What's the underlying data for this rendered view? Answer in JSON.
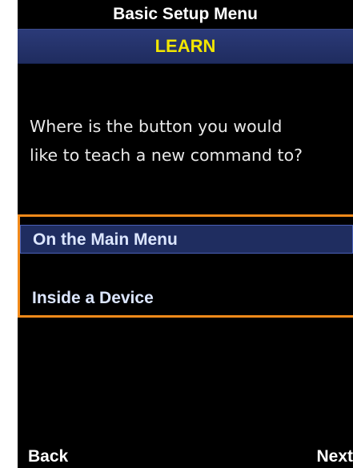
{
  "header": {
    "title": "Basic Setup Menu",
    "subtitle": "LEARN"
  },
  "prompt": {
    "text": "Where is the button you would\nlike to teach a new command to?"
  },
  "options": [
    {
      "label": "On the Main Menu",
      "selected": true
    },
    {
      "label": "Inside a Device",
      "selected": false
    }
  ],
  "softkeys": {
    "left": "Back",
    "right": "Next"
  },
  "colors": {
    "background": "#000000",
    "header_band": "#243270",
    "subtitle_text": "#f2e600",
    "selection_frame": "#f28a1a",
    "selected_row": "#1f2d60"
  }
}
